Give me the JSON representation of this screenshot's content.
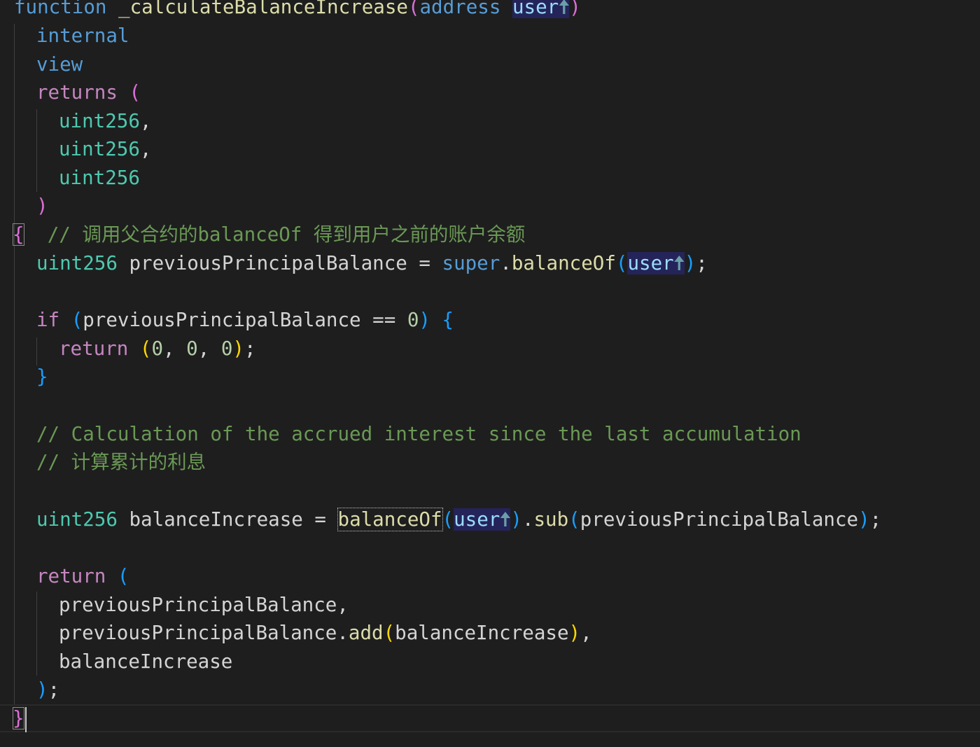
{
  "colors": {
    "background": "#1e1e1e",
    "keyword_blue": "#569cd6",
    "keyword_purple": "#c586c0",
    "function_yellow": "#dcdcaa",
    "param_blue": "#9cdcfe",
    "type_teal": "#4ec9b0",
    "comment_green": "#6a9955",
    "number_green": "#b5cea8",
    "bracket_gold": "#ffd700",
    "bracket_pink": "#da70d6",
    "bracket_blue": "#179fff",
    "text_default": "#d4d4d4"
  },
  "code": {
    "l1": {
      "kw": "function",
      "name": "_calculateBalanceIncrease",
      "open": "(",
      "ptype": "address",
      "param": "user",
      "arrow": "🠅",
      "close": ")"
    },
    "l2": {
      "kw": "internal"
    },
    "l3": {
      "kw": "view"
    },
    "l4": {
      "kw": "returns",
      "open": "("
    },
    "l5": {
      "type": "uint256",
      "punct": ","
    },
    "l6": {
      "type": "uint256",
      "punct": ","
    },
    "l7": {
      "type": "uint256"
    },
    "l8": {
      "close": ")"
    },
    "l9": {
      "brace": "{",
      "comment": "// 调用父合约的balanceOf 得到用户之前的账户余额"
    },
    "l10": {
      "type": "uint256",
      "var": "previousPrincipalBalance",
      "op": "=",
      "sup": "super",
      "dot": ".",
      "fn": "balanceOf",
      "open": "(",
      "param": "user",
      "arrow": "🠅",
      "close": ")",
      "semi": ";"
    },
    "l12": {
      "kw": "if",
      "open": "(",
      "var": "previousPrincipalBalance",
      "op": "==",
      "num": "0",
      "close": ")",
      "brace": "{"
    },
    "l13": {
      "kw": "return",
      "open": "(",
      "n1": "0",
      "comma": ",",
      "n2": "0",
      "n3": "0",
      "close": ")",
      "semi": ";"
    },
    "l14": {
      "brace": "}"
    },
    "l16": {
      "comment": "// Calculation of the accrued interest since the last accumulation"
    },
    "l17": {
      "comment": "// 计算累计的利息"
    },
    "l19": {
      "type": "uint256",
      "var": "balanceIncrease",
      "op": "=",
      "fn": "balanceOf",
      "open": "(",
      "param": "user",
      "arrow": "🠅",
      "close": ")",
      "dot": ".",
      "fn2": "sub",
      "open2": "(",
      "arg": "previousPrincipalBalance",
      "close2": ")",
      "semi": ";"
    },
    "l21": {
      "kw": "return",
      "open": "("
    },
    "l22": {
      "var": "previousPrincipalBalance",
      "comma": ","
    },
    "l23": {
      "var": "previousPrincipalBalance",
      "dot": ".",
      "fn": "add",
      "open": "(",
      "arg": "balanceIncrease",
      "close": ")",
      "comma": ","
    },
    "l24": {
      "var": "balanceIncrease"
    },
    "l25": {
      "close": ")",
      "semi": ";"
    },
    "l26": {
      "brace": "}"
    }
  }
}
